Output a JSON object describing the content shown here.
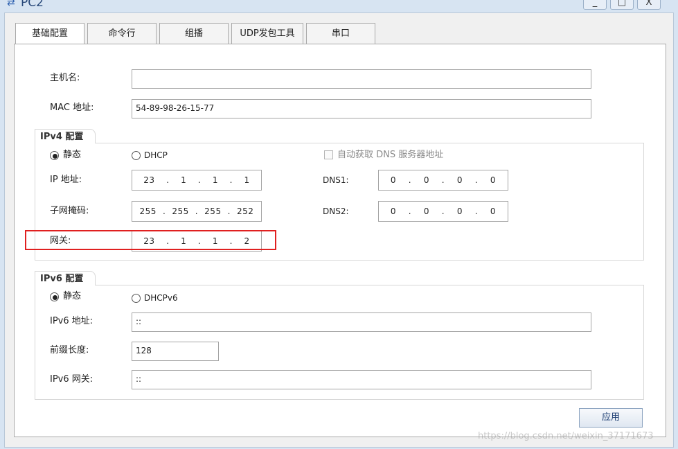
{
  "window": {
    "title": "PC2",
    "controls": [
      "_",
      "□",
      "X"
    ]
  },
  "tabs": [
    "基础配置",
    "命令行",
    "组播",
    "UDP发包工具",
    "串口"
  ],
  "basic": {
    "hostname_label": "主机名:",
    "hostname_value": "",
    "mac_label": "MAC 地址:",
    "mac_value": "54-89-98-26-15-77"
  },
  "ipv4": {
    "group_label": "IPv4 配置",
    "static_label": "静态",
    "dhcp_label": "DHCP",
    "auto_dns_label": "自动获取 DNS 服务器地址",
    "ip_label": "IP 地址:",
    "ip": [
      "23",
      "1",
      "1",
      "1"
    ],
    "mask_label": "子网掩码:",
    "mask": [
      "255",
      "255",
      "255",
      "252"
    ],
    "gateway_label": "网关:",
    "gateway": [
      "23",
      "1",
      "1",
      "2"
    ],
    "dns1_label": "DNS1:",
    "dns1": [
      "0",
      "0",
      "0",
      "0"
    ],
    "dns2_label": "DNS2:",
    "dns2": [
      "0",
      "0",
      "0",
      "0"
    ]
  },
  "ipv6": {
    "group_label": "IPv6 配置",
    "static_label": "静态",
    "dhcp_label": "DHCPv6",
    "ip_label": "IPv6 地址:",
    "ip_value": "::",
    "prefix_label": "前缀长度:",
    "prefix_value": "128",
    "gateway_label": "IPv6 网关:",
    "gateway_value": "::"
  },
  "apply_label": "应用",
  "watermark": "https://blog.csdn.net/weixin_37171673"
}
